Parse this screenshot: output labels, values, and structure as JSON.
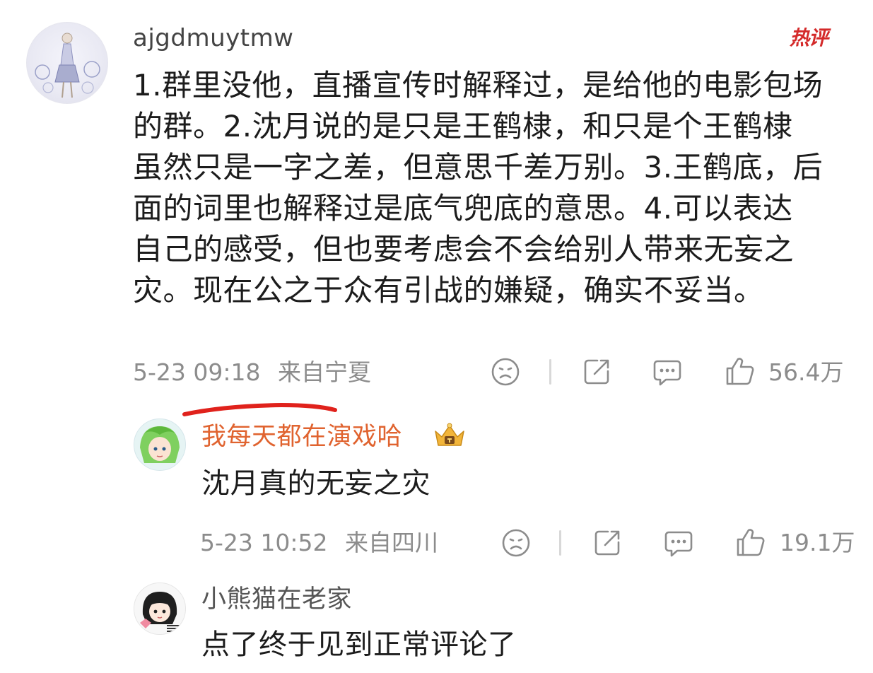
{
  "main_comment": {
    "username": "ajgdmuytmw",
    "badge": "热评",
    "body": "1.群里没他，直播宣传时解释过，是给他的电影包场\n的群。2.沈月说的是只是王鹤棣，和只是个王鹤棣\n虽然只是一字之差，但意思千差万别。3.王鹤底，后\n面的词里也解释过是底气兜底的意思。4.可以表达\n自己的感受，但也要考虑会不会给别人带来无妄之\n灾。现在公之于众有引战的嫌疑，确实不妥当。",
    "date": "5-23 09:18",
    "location": "来自宁夏",
    "likes": "56.4万",
    "icons": [
      "dislike-face-icon",
      "share-icon",
      "comment-icon",
      "thumbs-up-icon"
    ]
  },
  "replies": [
    {
      "username": "我每天都在演戏哈",
      "body": "沈月真的无妄之灾",
      "date": "5-23 10:52",
      "location": "来自四川",
      "likes": "19.1万",
      "username_color": "#e0632f",
      "badge_icon": "crown-icon"
    },
    {
      "username": "小熊猫在老家",
      "body": "点了终于见到正常评论了"
    }
  ],
  "colors": {
    "accent_red": "#d42a2a",
    "highlight_underline": "#e0221c",
    "meta_gray": "#8c8c8c"
  }
}
